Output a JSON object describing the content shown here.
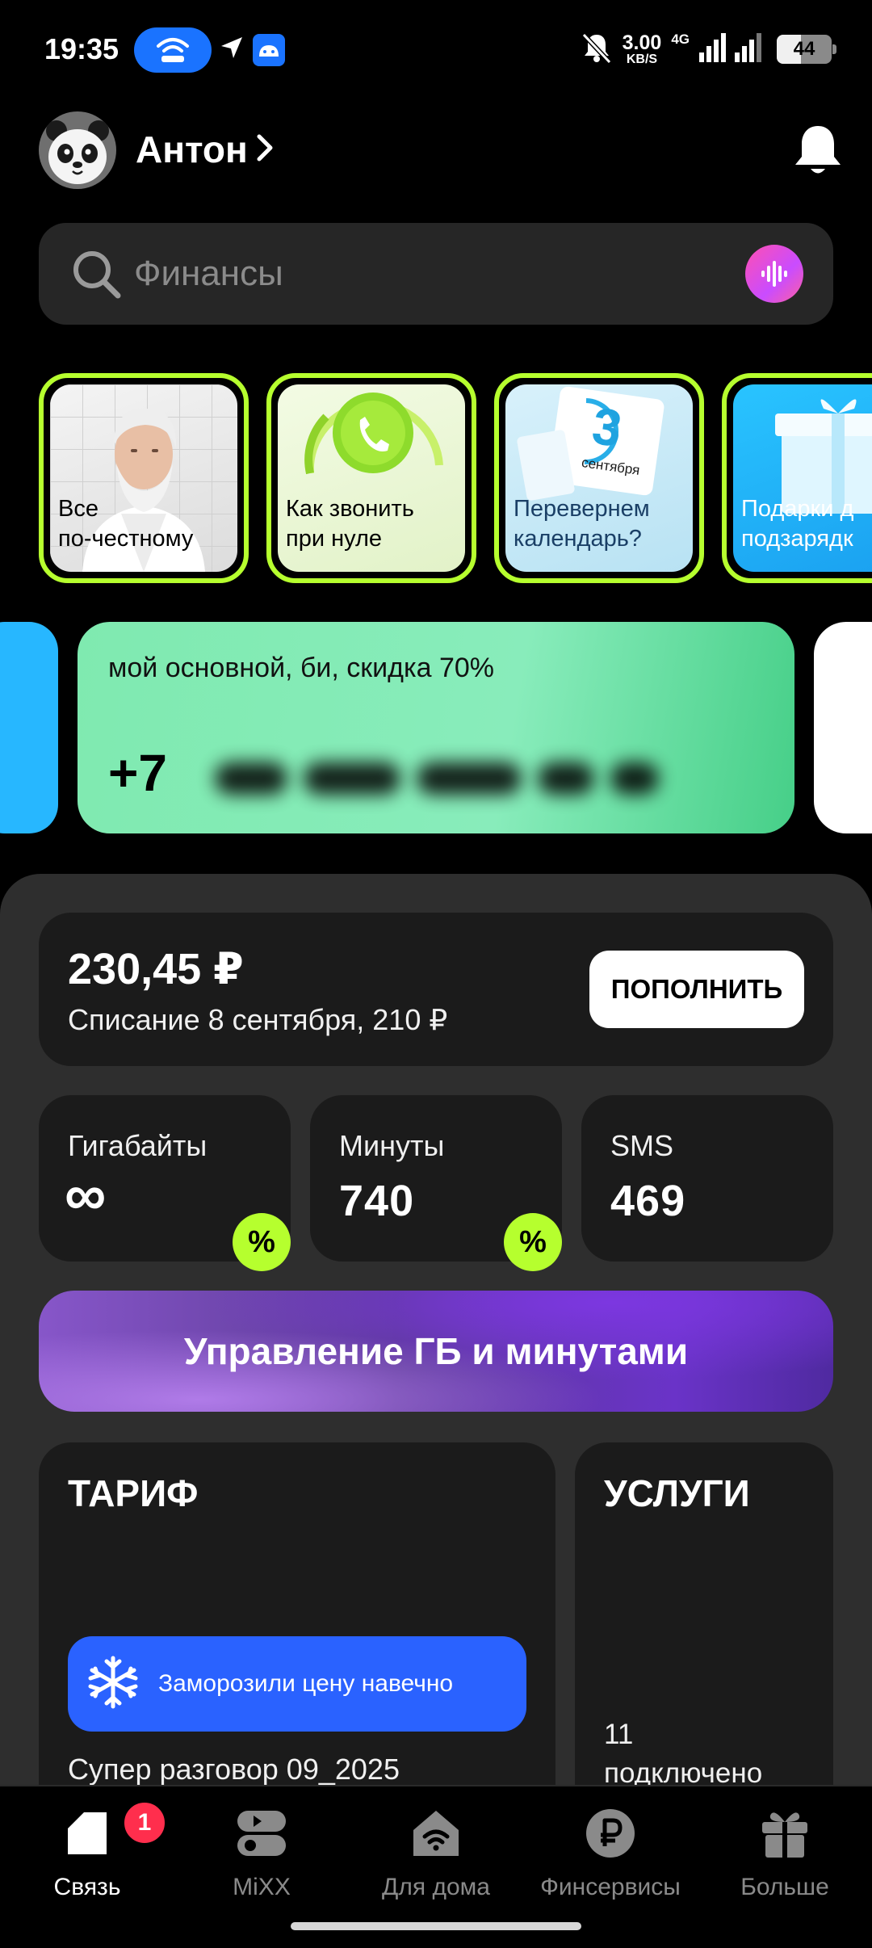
{
  "status_bar": {
    "time": "19:35",
    "speed_value": "3.00",
    "speed_unit": "KB/S",
    "network": "4G",
    "battery": "44",
    "icons": [
      "hotspot-icon",
      "navigation-icon",
      "android-icon",
      "mute-icon",
      "signal-icon",
      "battery-icon"
    ]
  },
  "header": {
    "user_name": "Антон",
    "icons": [
      "avatar-panda",
      "chevron-right-icon",
      "bell-icon"
    ]
  },
  "search": {
    "placeholder": "Финансы",
    "icons": [
      "search-icon",
      "voice-icon"
    ]
  },
  "stories": [
    {
      "label_line1": "Все",
      "label_line2": "по-честному"
    },
    {
      "label_line1": "Как звонить",
      "label_line2": "при нуле"
    },
    {
      "label_line1": "Перевернем",
      "label_line2": "календарь?",
      "calendar_day": "3",
      "calendar_month": "сентября"
    },
    {
      "label_line1": "Подарки д",
      "label_line2": "подзарядк"
    }
  ],
  "number_card": {
    "title": "мой основной, би, скидка 70%",
    "number_visible": "+7"
  },
  "balance": {
    "amount": "230,45 ₽",
    "charge": "Списание 8 сентября, 210 ₽",
    "topup_label": "ПОПОЛНИТЬ"
  },
  "stats": [
    {
      "label": "Гигабайты",
      "value": "∞",
      "badge": "%"
    },
    {
      "label": "Минуты",
      "value": "740",
      "badge": "%"
    },
    {
      "label": "SMS",
      "value": "469"
    }
  ],
  "manage_button": "Управление ГБ и минутами",
  "tariff": {
    "title": "ТАРИФ",
    "freeze_text": "Заморозили цену навечно",
    "name": "Супер разговор 09_2025"
  },
  "services": {
    "title": "УСЛУГИ",
    "count_line1": "11",
    "count_line2": "подключено"
  },
  "bottom_nav": [
    {
      "label": "Связь",
      "active": true,
      "badge": "1"
    },
    {
      "label": "MiXX"
    },
    {
      "label": "Для дома"
    },
    {
      "label": "Финсервисы"
    },
    {
      "label": "Больше"
    }
  ],
  "colors": {
    "accent_lime": "#b6ff2e",
    "card_dark": "#1b1b1b",
    "sheet": "#2e2e2e",
    "freeze_blue": "#2a62ff",
    "badge_red": "#ff2e4d",
    "number_card_green": "#7feab0"
  }
}
